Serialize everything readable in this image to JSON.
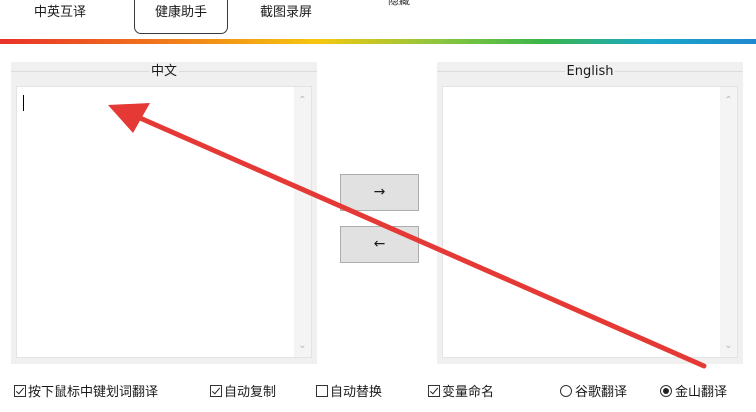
{
  "tabs": [
    {
      "label": "中英互译",
      "active": false
    },
    {
      "label": "健康助手",
      "active": true
    },
    {
      "label": "截图录屏",
      "active": false
    }
  ],
  "hidden_label": "隐藏",
  "chinese_panel": {
    "title": "中文",
    "text": ""
  },
  "english_panel": {
    "title": "English",
    "text": ""
  },
  "buttons": {
    "to_english": "→",
    "to_chinese": "←"
  },
  "options": {
    "checkboxes": [
      {
        "label": "按下鼠标中键划词翻译",
        "checked": true
      },
      {
        "label": "自动复制",
        "checked": true
      },
      {
        "label": "自动替换",
        "checked": false
      },
      {
        "label": "变量命名",
        "checked": true
      }
    ],
    "engines": [
      {
        "label": "谷歌翻译",
        "selected": false
      },
      {
        "label": "金山翻译",
        "selected": true
      }
    ]
  },
  "colors": {
    "annotation_arrow": "#e53935",
    "rainbow": [
      "#e8312a",
      "#f07a1a",
      "#f5c70f",
      "#8cc63f",
      "#39b54a",
      "#1aa8c8",
      "#1e88d0"
    ]
  }
}
